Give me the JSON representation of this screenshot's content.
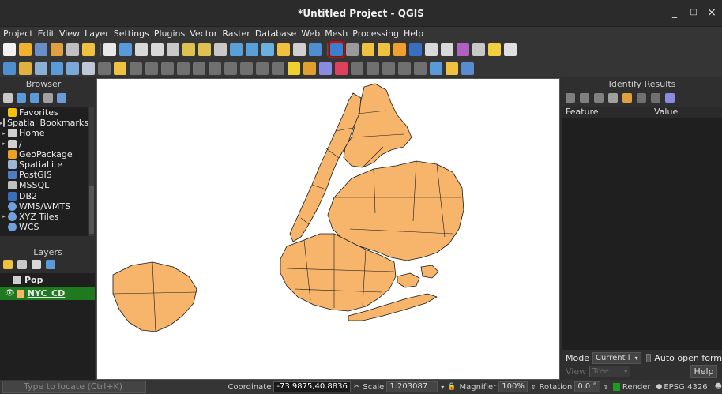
{
  "window": {
    "title": "*Untitled Project - QGIS",
    "minimize": "_",
    "maximize": "□",
    "close": "×"
  },
  "menu": [
    "Project",
    "Edit",
    "View",
    "Layer",
    "Settings",
    "Plugins",
    "Vector",
    "Raster",
    "Database",
    "Web",
    "Mesh",
    "Processing",
    "Help"
  ],
  "browser": {
    "title": "Browser",
    "items": [
      {
        "label": "Favorites",
        "icon": "star-icon",
        "arrow": "",
        "color": "#f4c20d"
      },
      {
        "label": "Spatial Bookmarks",
        "icon": "bookmark-icon",
        "arrow": "▸",
        "color": "#bfbfbf"
      },
      {
        "label": "Home",
        "icon": "home-folder-icon",
        "arrow": "▸",
        "color": "#cfcfcf"
      },
      {
        "label": "/",
        "icon": "folder-icon",
        "arrow": "▸",
        "color": "#cfcfcf"
      },
      {
        "label": "GeoPackage",
        "icon": "geopackage-icon",
        "arrow": "",
        "color": "#f0a020"
      },
      {
        "label": "SpatiaLite",
        "icon": "spatialite-icon",
        "arrow": "",
        "color": "#9bb7d4"
      },
      {
        "label": "PostGIS",
        "icon": "postgis-icon",
        "arrow": "",
        "color": "#4f7fc0"
      },
      {
        "label": "MSSQL",
        "icon": "mssql-icon",
        "arrow": "",
        "color": "#c0c0c0"
      },
      {
        "label": "DB2",
        "icon": "db2-icon",
        "arrow": "",
        "color": "#3a6fc0"
      },
      {
        "label": "WMS/WMTS",
        "icon": "wms-globe-icon",
        "arrow": "",
        "color": "#6fa0d8"
      },
      {
        "label": "XYZ Tiles",
        "icon": "xyz-globe-icon",
        "arrow": "▸",
        "color": "#6fa0d8"
      },
      {
        "label": "WCS",
        "icon": "wcs-globe-icon",
        "arrow": "",
        "color": "#6fa0d8"
      }
    ]
  },
  "layers": {
    "title": "Layers",
    "items": [
      {
        "label": "Pop",
        "icon": "table-icon",
        "selected": false
      },
      {
        "label": "NYC_CD",
        "icon": "polygon-layer-icon",
        "selected": true
      }
    ]
  },
  "identify": {
    "title": "Identify Results",
    "columns": [
      "Feature",
      "Value"
    ],
    "mode_label": "Mode",
    "mode_value": "Current l",
    "auto_open_label": "Auto open form",
    "view_label": "View",
    "view_value": "Tree",
    "help_label": "Help"
  },
  "map": {
    "fill_color": "#f7b56b",
    "stroke_color": "#1a1a1a"
  },
  "status": {
    "locate_placeholder": "Type to locate (Ctrl+K)",
    "coordinate_label": "Coordinate",
    "coordinate_value": "-73.9875,40.8836",
    "scale_label": "Scale",
    "scale_value": "1:203087",
    "magnifier_label": "Magnifier",
    "magnifier_value": "100%",
    "rotation_label": "Rotation",
    "rotation_value": "0.0 °",
    "render_label": "Render",
    "crs_label": "EPSG:4326"
  }
}
